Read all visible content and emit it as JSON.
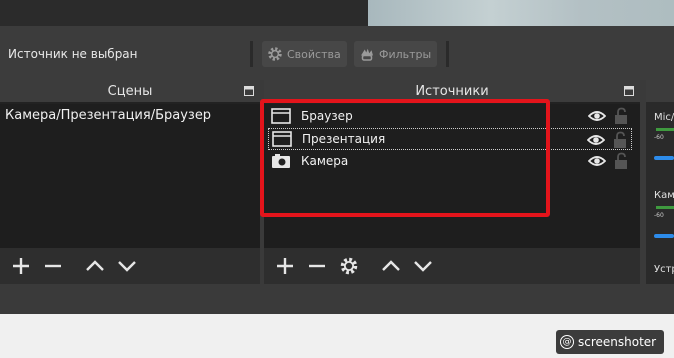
{
  "context_bar": {
    "no_source": "Источник не выбран",
    "properties_label": "Свойства",
    "filters_label": "Фильтры"
  },
  "scenes": {
    "title": "Сцены",
    "items": [
      {
        "label": "Камера/Презентация/Браузер"
      }
    ]
  },
  "sources": {
    "title": "Источники",
    "items": [
      {
        "label": "Браузер",
        "icon": "browser-window-icon"
      },
      {
        "label": "Презентация",
        "icon": "display-capture-icon"
      },
      {
        "label": "Камера",
        "icon": "camera-icon"
      }
    ]
  },
  "mixer": {
    "channels": [
      {
        "label": "Mic/",
        "scale": "-60"
      },
      {
        "label": "Кам",
        "scale": "-60"
      },
      {
        "label": "Устр"
      }
    ]
  },
  "watermark": {
    "text": "screenshoter"
  },
  "colors": {
    "highlight": "#e3141b",
    "slider": "#2d8ceb",
    "meter": "#3f9a3f"
  }
}
